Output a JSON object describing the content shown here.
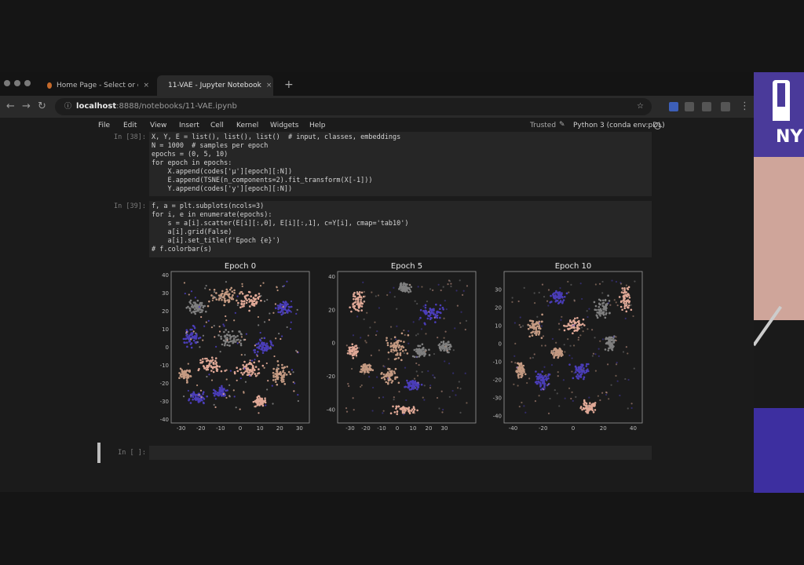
{
  "browser": {
    "tabs": [
      {
        "label": "Home Page - Select or create a",
        "close": "×"
      },
      {
        "label": "11-VAE - Jupyter Notebook",
        "close": "×"
      }
    ],
    "new_tab": "+",
    "url_host": "localhost",
    "url_path": ":8888/notebooks/11-VAE.ipynb"
  },
  "menu": {
    "items": [
      "File",
      "Edit",
      "View",
      "Insert",
      "Cell",
      "Kernel",
      "Widgets",
      "Help"
    ],
    "trusted": "Trusted",
    "kernel": "Python 3 (conda env:pDL)"
  },
  "cell1": {
    "prompt": "In [38]:",
    "lines": [
      "X, Y, E = list(), list(), list()  # input, classes, embeddings",
      "N = 1000  # samples per epoch",
      "epochs = (0, 5, 10)",
      "for epoch in epochs:",
      "    X.append(codes['μ'][epoch][:N])",
      "    E.append(TSNE(n_components=2).fit_transform(X[-1]))",
      "    Y.append(codes['y'][epoch][:N])"
    ]
  },
  "cell2": {
    "prompt": "In [39]:",
    "lines": [
      "f, a = plt.subplots(ncols=3)",
      "for i, e in enumerate(epochs):",
      "    s = a[i].scatter(E[i][:,0], E[i][:,1], c=Y[i], cmap='tab10')",
      "    a[i].grid(False)",
      "    a[i].set_title(f'Epoch {e}')",
      "# f.colorbar(s)"
    ]
  },
  "cell3": {
    "prompt": "In [ ]:"
  },
  "chart_data": [
    {
      "type": "scatter",
      "title": "Epoch 0",
      "xlim": [
        -35,
        35
      ],
      "ylim": [
        -42,
        42
      ],
      "xticks": [
        -30,
        -20,
        -10,
        0,
        10,
        20,
        30
      ],
      "yticks": [
        -40,
        -30,
        -20,
        -10,
        0,
        10,
        20,
        30,
        40
      ],
      "grid": false
    },
    {
      "type": "scatter",
      "title": "Epoch 5",
      "xlim": [
        -38,
        50
      ],
      "ylim": [
        -48,
        43
      ],
      "xticks": [
        -30,
        -20,
        -10,
        0,
        10,
        20,
        30
      ],
      "yticks": [
        -40,
        -20,
        0,
        20,
        40
      ],
      "grid": false
    },
    {
      "type": "scatter",
      "title": "Epoch 10",
      "xlim": [
        -46,
        46
      ],
      "ylim": [
        -44,
        40
      ],
      "xticks": [
        -40,
        -20,
        0,
        20,
        40
      ],
      "yticks": [
        -40,
        -30,
        -20,
        -10,
        0,
        10,
        20,
        30
      ],
      "grid": false
    }
  ],
  "colors": {
    "pink": "#e0a896",
    "gray": "#7f7f7f",
    "blue": "#4a3db8",
    "tan": "#c49a82"
  },
  "video": {
    "logo_text": "NY"
  }
}
